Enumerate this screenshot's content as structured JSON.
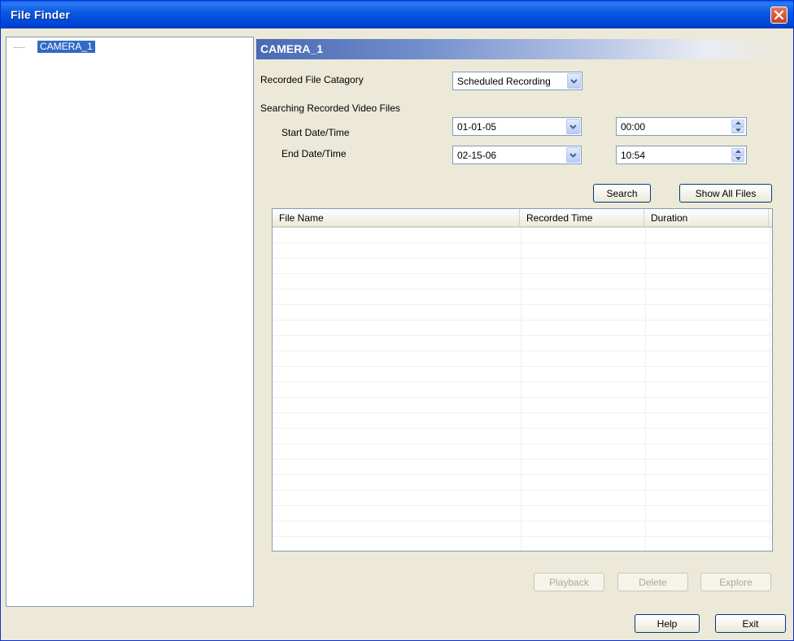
{
  "window": {
    "title": "File Finder"
  },
  "tree": {
    "items": [
      {
        "label": "CAMERA_1",
        "selected": true
      }
    ]
  },
  "panel": {
    "header": "CAMERA_1",
    "category_label": "Recorded File Catagory",
    "category_value": "Scheduled Recording",
    "search_section_label": "Searching Recorded Video Files",
    "start_label": "Start Date/Time",
    "start_date": "01-01-05",
    "start_time": "00:00",
    "end_label": "End Date/Time",
    "end_date": "02-15-06",
    "end_time": "10:54",
    "search_button": "Search",
    "show_all_button": "Show All Files"
  },
  "file_list": {
    "columns": [
      "File Name",
      "Recorded Time",
      "Duration"
    ],
    "rows": []
  },
  "actions": {
    "playback": "Playback",
    "delete": "Delete",
    "explore": "Explore"
  },
  "footer": {
    "help": "Help",
    "exit": "Exit"
  },
  "colors": {
    "titlebar": "#0a5ae4",
    "selection": "#316ac5",
    "window_bg": "#ece9d8"
  }
}
